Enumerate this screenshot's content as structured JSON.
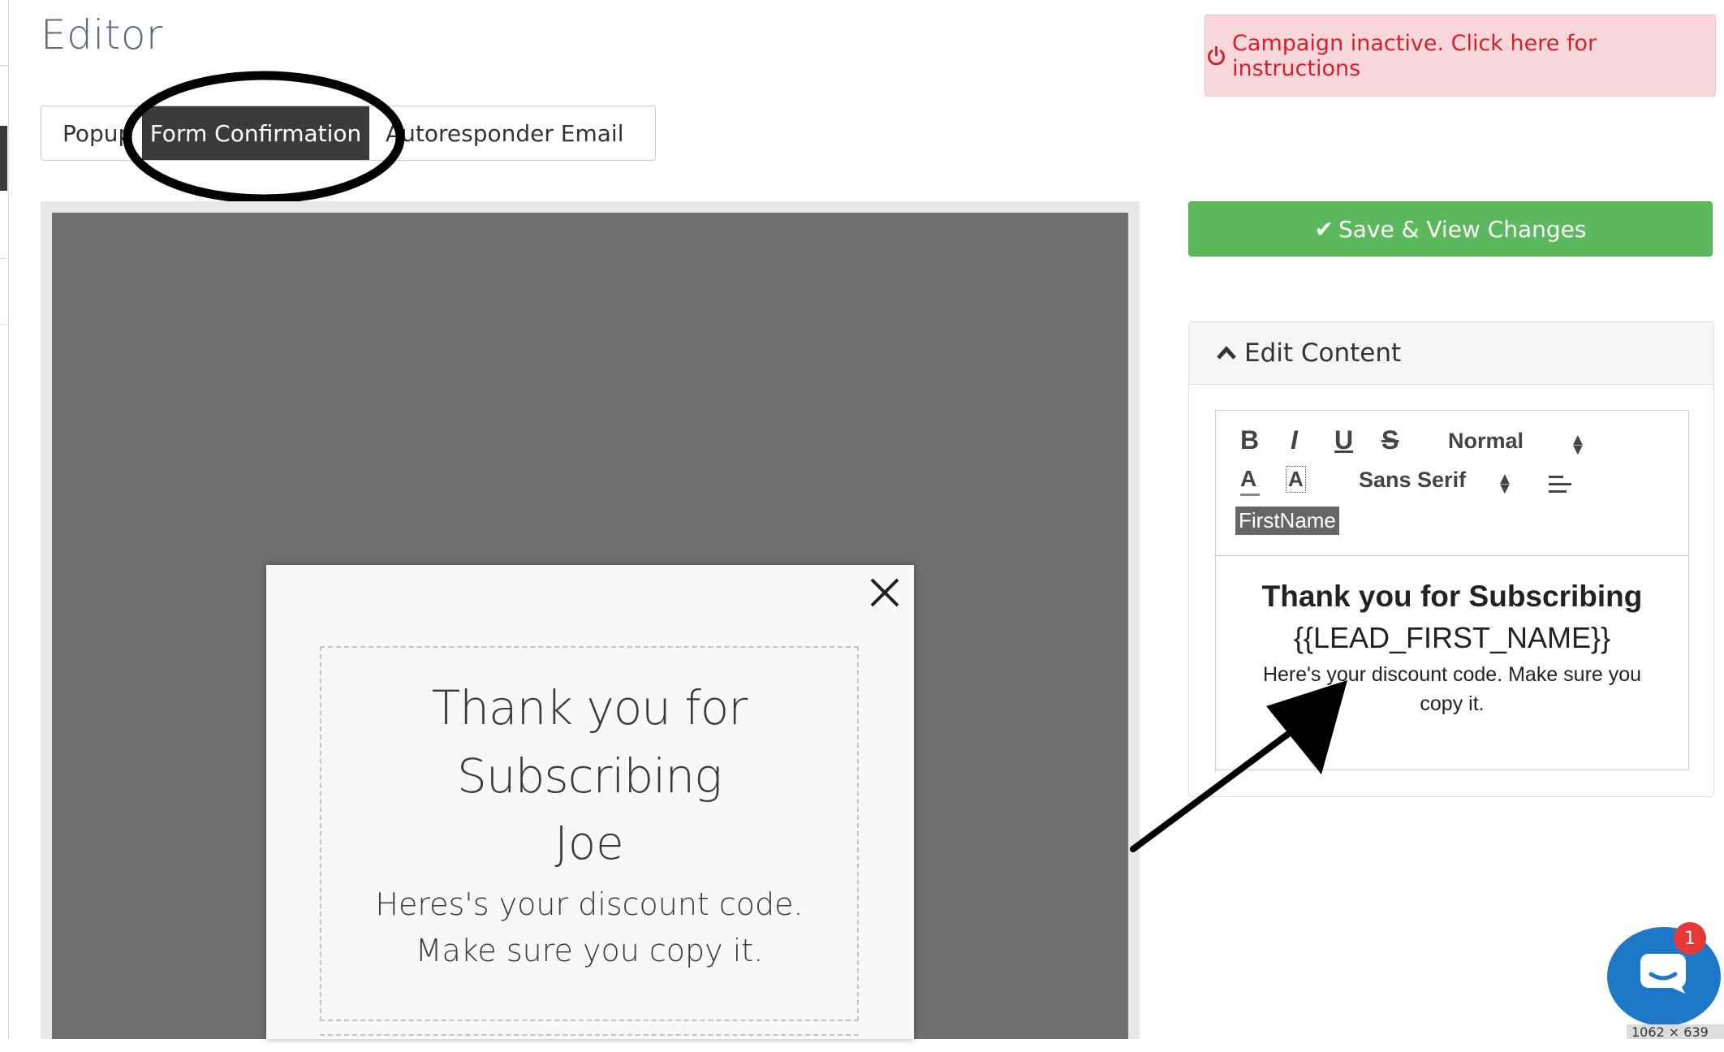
{
  "header": {
    "title": "Editor"
  },
  "tabs": [
    {
      "label": "Popup"
    },
    {
      "label": "Form Confirmation",
      "active": true
    },
    {
      "label": "Autoresponder Email"
    }
  ],
  "alert": {
    "icon": "power-icon",
    "text": "Campaign inactive. Click here for instructions",
    "color": "#d0212f"
  },
  "preview": {
    "heading": "Thank you for Subscribing",
    "name": "Joe",
    "body": "Heres's your discount code. Make sure you copy it."
  },
  "sidebar": {
    "save_label": "Save & View Changes",
    "save_color": "#5cb85c",
    "edit_content_label": "Edit Content",
    "toolbar": {
      "bold": "B",
      "italic": "I",
      "underline": "U",
      "strike": "S",
      "size": "Normal",
      "font_color": "A",
      "background_color": "A",
      "font": "Sans Serif",
      "token": "FirstName"
    },
    "editor": {
      "heading": "Thank you for Subscribing",
      "token": "{{LEAD_FIRST_NAME}}",
      "body": "Here's your discount code. Make sure you copy it."
    }
  },
  "chat": {
    "badge_count": "1",
    "dimensions_label": "1062 × 639"
  }
}
